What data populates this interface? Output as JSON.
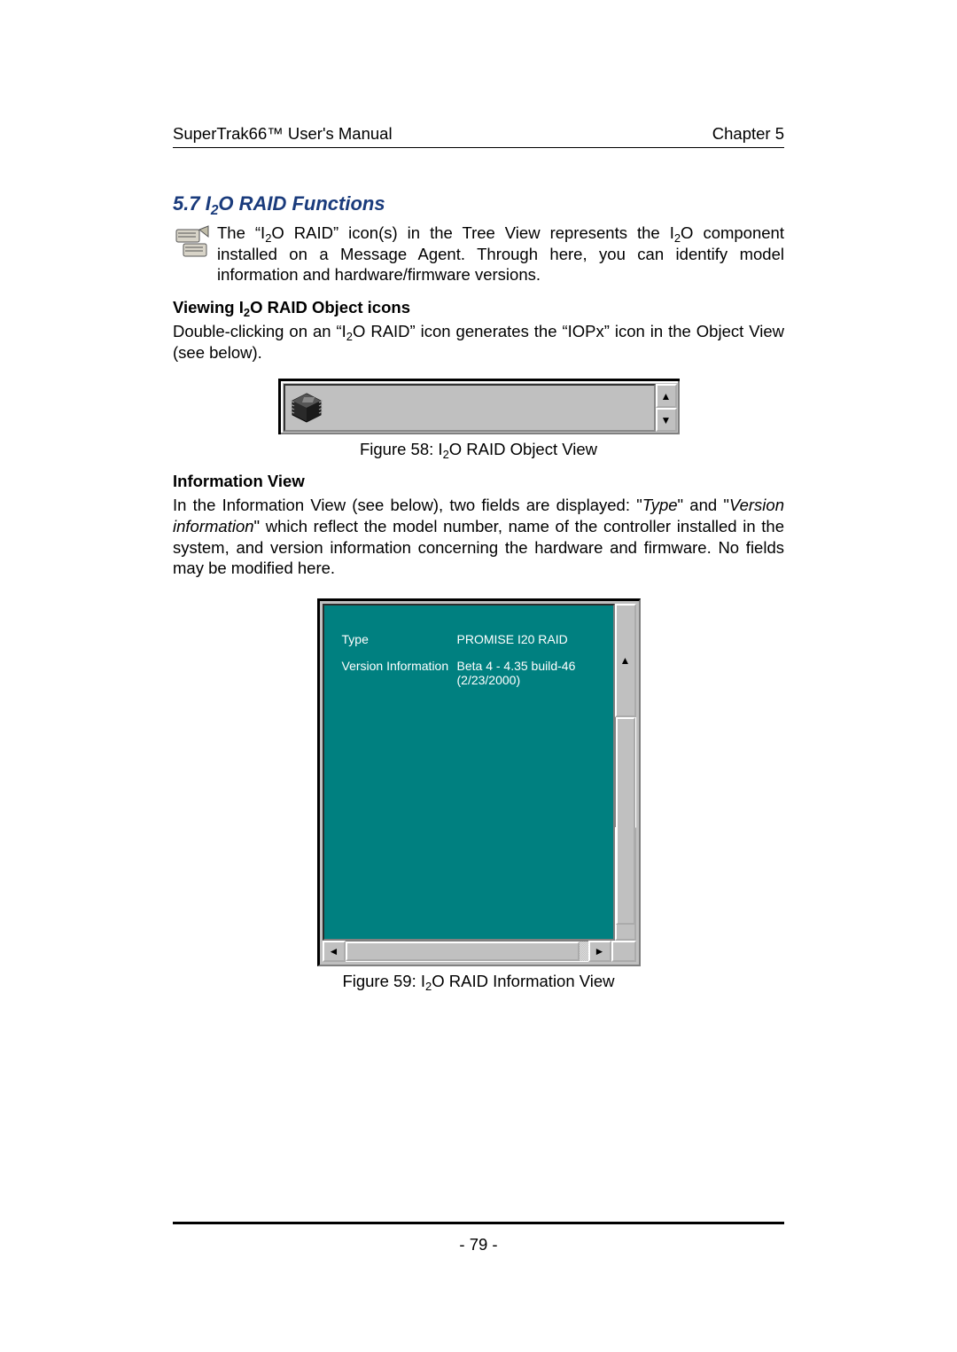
{
  "header": {
    "left": "SuperTrak66™ User's Manual",
    "right": "Chapter 5"
  },
  "section": {
    "title": "5.7 I2O RAID Functions",
    "intro": "The \"I2O RAID\" icon(s) in the Tree View represents the I2O component installed on a Message Agent. Through here, you can identify model information and hardware/firmware versions."
  },
  "sub1": {
    "heading": "Viewing I2O RAID Object icons",
    "text": "Double-clicking on an \"I2O RAID\" icon generates the \"IOPx\" icon in the Object View (see below)."
  },
  "fig58": {
    "caption": "Figure 58: I2O RAID Object View"
  },
  "sub2": {
    "heading": "Information View",
    "text_pre": "In the Information View (see below), two fields are displayed: \"",
    "type_word": "Type",
    "text_mid": "\" and \"",
    "version_word": "Version information",
    "text_post": "\" which reflect the model number, name of the controller installed in the system, and version information concerning the hardware and firmware. No fields may be modified here."
  },
  "fig59": {
    "rows": [
      {
        "label": "Type",
        "value": "PROMISE I20 RAID"
      },
      {
        "label": "Version Information",
        "value": "Beta 4 - 4.35 build-46 (2/23/2000)"
      }
    ],
    "caption": "Figure 59: I2O RAID Information View"
  },
  "footer": {
    "page": "- 79 -"
  }
}
